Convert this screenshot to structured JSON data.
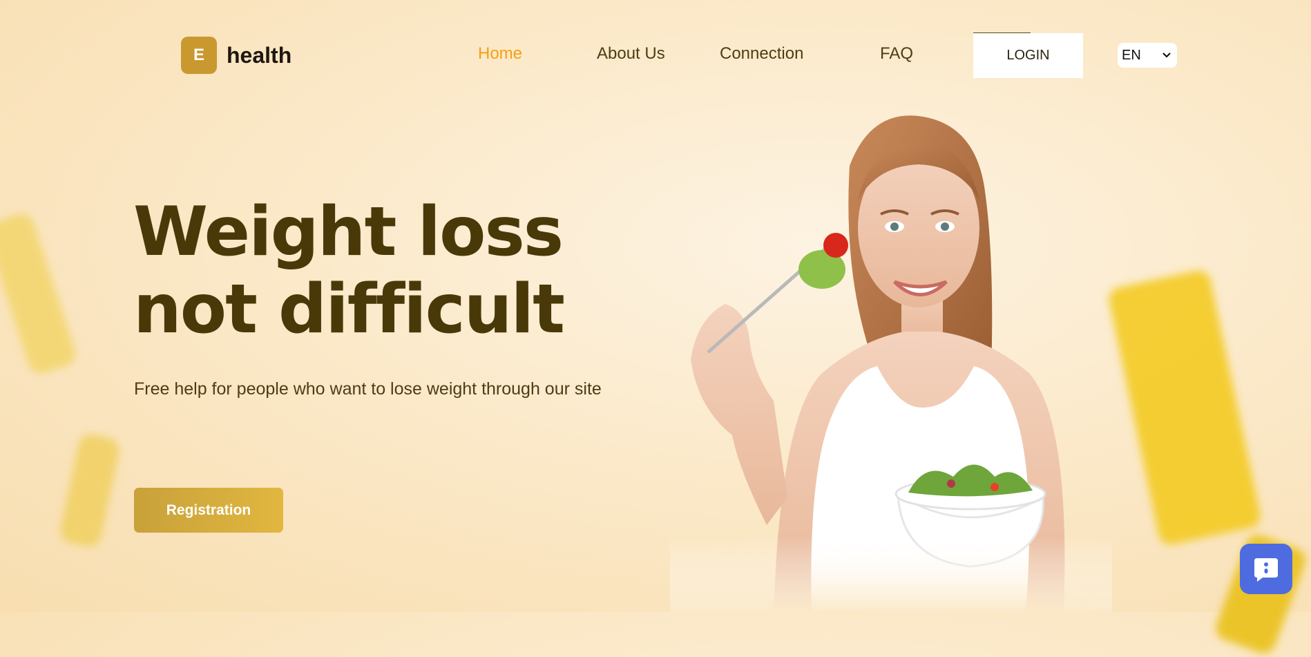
{
  "brand": {
    "badge": "E",
    "name": "health",
    "accent": "#c9992f"
  },
  "nav": {
    "items": [
      {
        "label": "Home",
        "active": true
      },
      {
        "label": "About Us"
      },
      {
        "label": "Connection"
      },
      {
        "label": "FAQ"
      }
    ],
    "login_label": "LOGIN",
    "language": {
      "selected": "EN"
    },
    "active_color": "#f5a011"
  },
  "hero": {
    "title": "Weight loss not difficult",
    "subtitle": "Free help for people who want to lose weight through our site",
    "cta_label": "Registration"
  },
  "icons": {
    "chat": "chat-bubble-icon",
    "lang_arrow": "chevron-down-icon"
  }
}
